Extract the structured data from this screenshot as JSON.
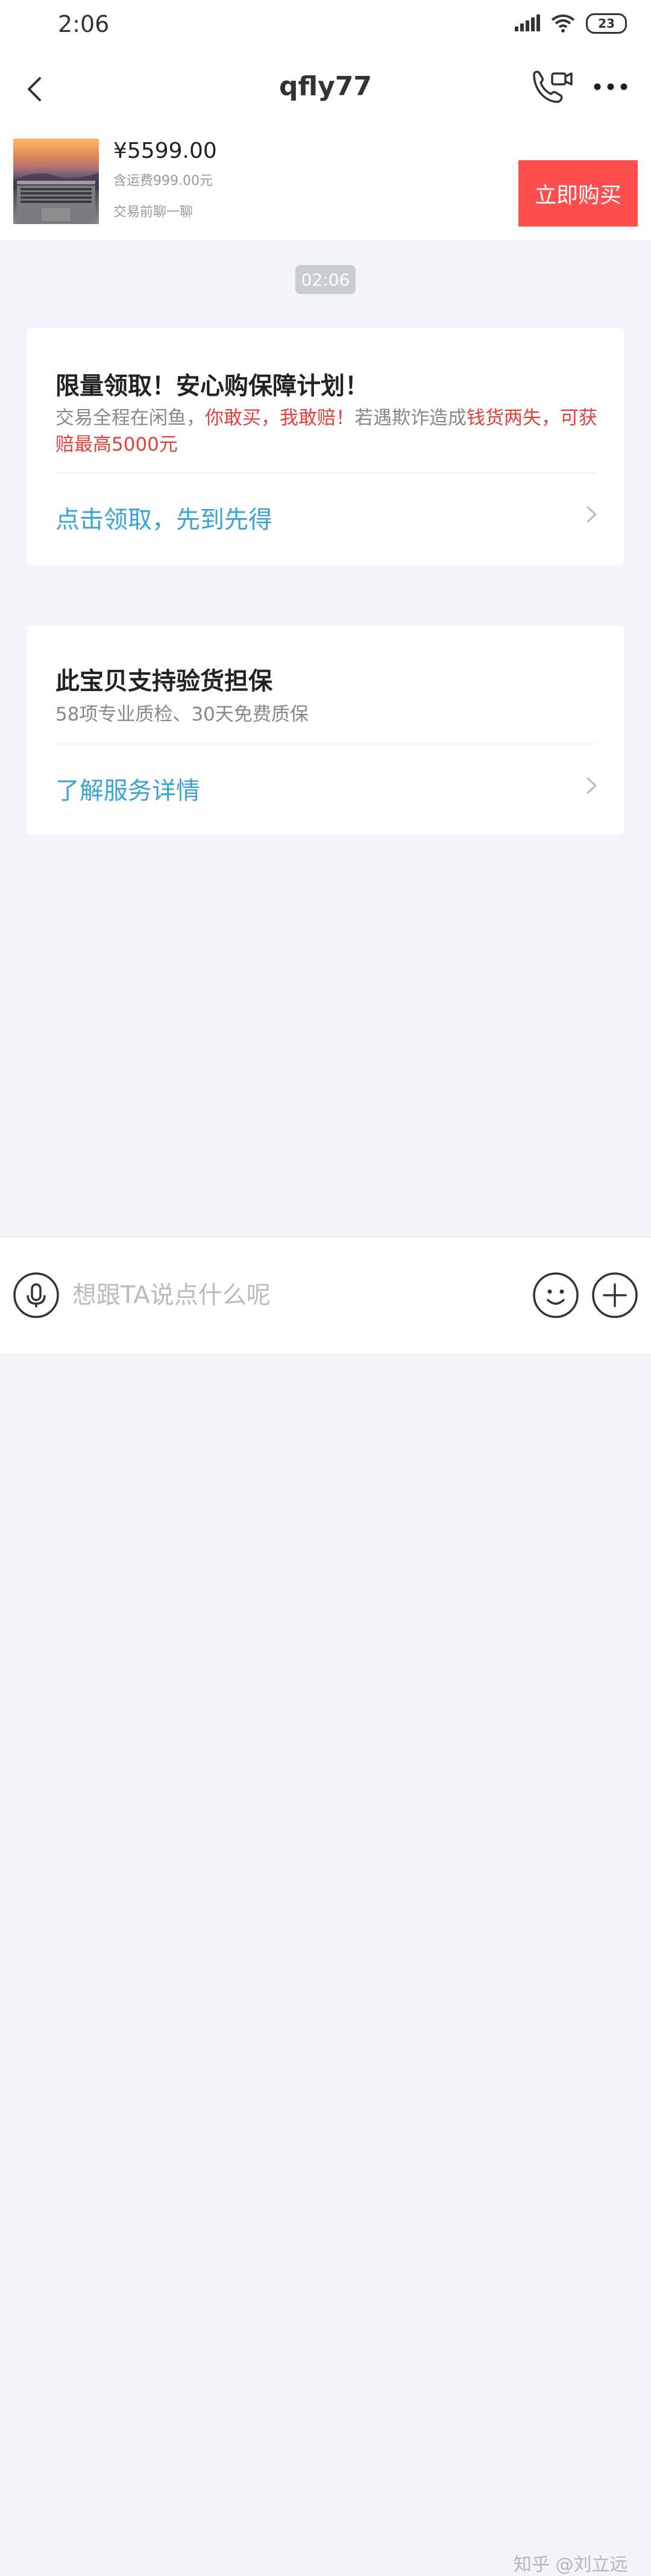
{
  "status_bar": {
    "time": "2:06",
    "battery": "23",
    "icons": [
      "signal-icon",
      "wifi-icon",
      "battery-icon"
    ]
  },
  "nav": {
    "title": "qfly77",
    "icons": [
      "back-icon",
      "call-video-icon",
      "more-icon"
    ]
  },
  "product": {
    "price": "¥5599.00",
    "shipping": "含运费999.00元",
    "hint": "交易前聊一聊",
    "buy_label": "立即购买"
  },
  "chat": {
    "timestamp": "02:06"
  },
  "card_protection": {
    "title": "限量领取！安心购保障计划！",
    "desc_1": "交易全程在闲鱼，",
    "desc_2": "你敢买，我敢赔！",
    "desc_3": "若遇欺诈造成",
    "desc_4": "钱货两失，可获赔最高5000元",
    "link": "点击领取，先到先得"
  },
  "card_inspection": {
    "title": "此宝贝支持验货担保",
    "desc": "58项专业质检、30天免费质保",
    "link": "了解服务详情"
  },
  "input": {
    "placeholder": "想跟TA说点什么呢",
    "icons": [
      "microphone-icon",
      "emoji-icon",
      "plus-icon"
    ]
  },
  "watermark": "知乎 @刘立远",
  "colors": {
    "accent_red": "#ff4e4e",
    "link_blue": "#3aa2d7",
    "warning_red": "#e3413c",
    "background": "#f3f5f8"
  }
}
